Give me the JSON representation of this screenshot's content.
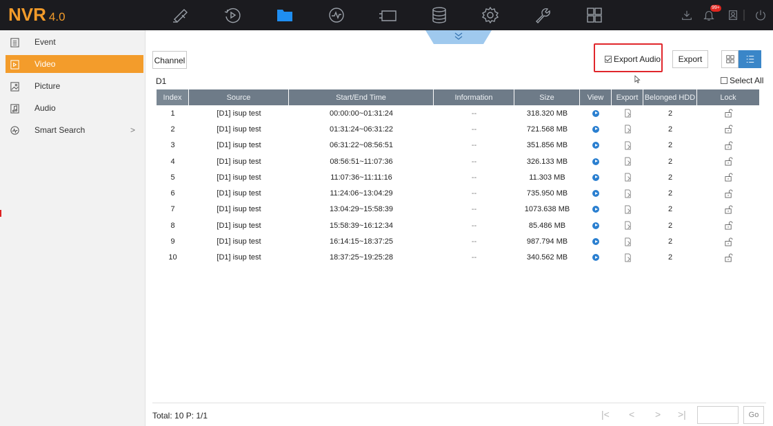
{
  "app": {
    "logo": "NVR",
    "version": "4.0",
    "alarm_badge": "99+",
    "accent": "#f39c2b"
  },
  "topnav": {
    "items": [
      {
        "name": "live-view",
        "icon": "camera-icon",
        "active": false
      },
      {
        "name": "playback",
        "icon": "playback-icon",
        "active": false
      },
      {
        "name": "file-management",
        "icon": "folder-icon",
        "active": true
      },
      {
        "name": "smart-analysis",
        "icon": "smart-icon",
        "active": false
      },
      {
        "name": "configuration-screen",
        "icon": "screen-icon",
        "active": false
      },
      {
        "name": "storage",
        "icon": "database-icon",
        "active": false
      },
      {
        "name": "system",
        "icon": "gear-icon",
        "active": false
      },
      {
        "name": "maintenance",
        "icon": "wrench-icon",
        "active": false
      },
      {
        "name": "layout",
        "icon": "grid-icon",
        "active": false
      }
    ]
  },
  "sidebar": {
    "items": [
      {
        "label": "Event",
        "icon": "event-icon",
        "active": false
      },
      {
        "label": "Video",
        "icon": "video-icon",
        "active": true
      },
      {
        "label": "Picture",
        "icon": "picture-icon",
        "active": false
      },
      {
        "label": "Audio",
        "icon": "audio-icon",
        "active": false
      },
      {
        "label": "Smart Search",
        "icon": "smart-search-icon",
        "active": false,
        "chevron": ">"
      }
    ]
  },
  "filter": {
    "channel_label": "Channel",
    "channel_value": "D1",
    "export_audio_label": "Export Audio",
    "export_audio_checked": true,
    "export_label": "Export",
    "select_all_label": "Select All",
    "select_all_checked": false
  },
  "table": {
    "headers": [
      "Index",
      "Source",
      "Start/End Time",
      "Information",
      "Size",
      "View",
      "Export",
      "Belonged HDD",
      "Lock"
    ],
    "rows": [
      {
        "index": "1",
        "source": "[D1] isup test",
        "time": "00:00:00~01:31:24",
        "info": "--",
        "size": "318.320 MB",
        "hdd": "2"
      },
      {
        "index": "2",
        "source": "[D1] isup test",
        "time": "01:31:24~06:31:22",
        "info": "--",
        "size": "721.568 MB",
        "hdd": "2"
      },
      {
        "index": "3",
        "source": "[D1] isup test",
        "time": "06:31:22~08:56:51",
        "info": "--",
        "size": "351.856 MB",
        "hdd": "2"
      },
      {
        "index": "4",
        "source": "[D1] isup test",
        "time": "08:56:51~11:07:36",
        "info": "--",
        "size": "326.133 MB",
        "hdd": "2"
      },
      {
        "index": "5",
        "source": "[D1] isup test",
        "time": "11:07:36~11:11:16",
        "info": "--",
        "size": "11.303 MB",
        "hdd": "2"
      },
      {
        "index": "6",
        "source": "[D1] isup test",
        "time": "11:24:06~13:04:29",
        "info": "--",
        "size": "735.950 MB",
        "hdd": "2"
      },
      {
        "index": "7",
        "source": "[D1] isup test",
        "time": "13:04:29~15:58:39",
        "info": "--",
        "size": "1073.638 MB",
        "hdd": "2"
      },
      {
        "index": "8",
        "source": "[D1] isup test",
        "time": "15:58:39~16:12:34",
        "info": "--",
        "size": "85.486 MB",
        "hdd": "2"
      },
      {
        "index": "9",
        "source": "[D1] isup test",
        "time": "16:14:15~18:37:25",
        "info": "--",
        "size": "987.794 MB",
        "hdd": "2"
      },
      {
        "index": "10",
        "source": "[D1] isup test",
        "time": "18:37:25~19:25:28",
        "info": "--",
        "size": "340.562 MB",
        "hdd": "2"
      }
    ]
  },
  "footer": {
    "total_text": "Total: 10  P: 1/1",
    "go_label": "Go",
    "first_glyph": "|<",
    "prev_glyph": "<",
    "next_glyph": ">",
    "last_glyph": ">|"
  }
}
